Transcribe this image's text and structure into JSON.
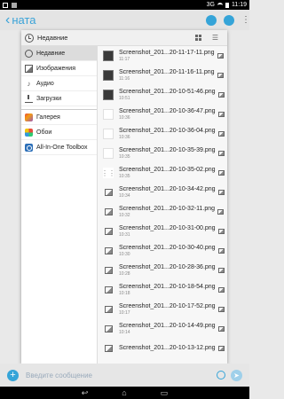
{
  "statusbar": {
    "network": "3G",
    "time": "11:19"
  },
  "appbar": {
    "title": "ната"
  },
  "dialog": {
    "title": "Недавние",
    "sidebar": [
      {
        "label": "Недавние",
        "icon": "clock-icon"
      },
      {
        "label": "Изображения",
        "icon": "image-icon"
      },
      {
        "label": "Аудио",
        "icon": "audio-icon"
      },
      {
        "label": "Загрузки",
        "icon": "download-icon"
      }
    ],
    "apps": [
      {
        "label": "Галерея",
        "icon": "gallery-icon"
      },
      {
        "label": "Обои",
        "icon": "wallpaper-icon"
      },
      {
        "label": "All-In-One Toolbox",
        "icon": "toolbox-icon"
      }
    ],
    "files": [
      {
        "name": "Screenshot_201...20-11-17-11.png",
        "time": "11:17",
        "thumb": "dark"
      },
      {
        "name": "Screenshot_201...20-11-16-11.png",
        "time": "11:16",
        "thumb": "dark"
      },
      {
        "name": "Screenshot_201...20-10-51-46.png",
        "time": "10:51",
        "thumb": "dark"
      },
      {
        "name": "Screenshot_201...20-10-36-47.png",
        "time": "10:36",
        "thumb": "light"
      },
      {
        "name": "Screenshot_201...20-10-36-04.png",
        "time": "10:36",
        "thumb": "light"
      },
      {
        "name": "Screenshot_201...20-10-35-39.png",
        "time": "10:35",
        "thumb": "light"
      },
      {
        "name": "Screenshot_201...20-10-35-02.png",
        "time": "10:35",
        "thumb": "dots"
      },
      {
        "name": "Screenshot_201...20-10-34-42.png",
        "time": "10:34",
        "thumb": "icon"
      },
      {
        "name": "Screenshot_201...20-10-32-11.png",
        "time": "10:32",
        "thumb": "icon"
      },
      {
        "name": "Screenshot_201...20-10-31-00.png",
        "time": "10:31",
        "thumb": "icon"
      },
      {
        "name": "Screenshot_201...20-10-30-40.png",
        "time": "10:30",
        "thumb": "icon"
      },
      {
        "name": "Screenshot_201...20-10-28-36.png",
        "time": "10:28",
        "thumb": "icon"
      },
      {
        "name": "Screenshot_201...20-10-18-54.png",
        "time": "10:18",
        "thumb": "icon"
      },
      {
        "name": "Screenshot_201...20-10-17-52.png",
        "time": "10:17",
        "thumb": "icon"
      },
      {
        "name": "Screenshot_201...20-10-14-49.png",
        "time": "10:14",
        "thumb": "icon"
      },
      {
        "name": "Screenshot_201...20-10-13-12.png",
        "time": "",
        "thumb": "icon"
      }
    ]
  },
  "compose": {
    "placeholder": "Введите сообщение"
  },
  "colors": {
    "accent": "#35a4d8"
  }
}
